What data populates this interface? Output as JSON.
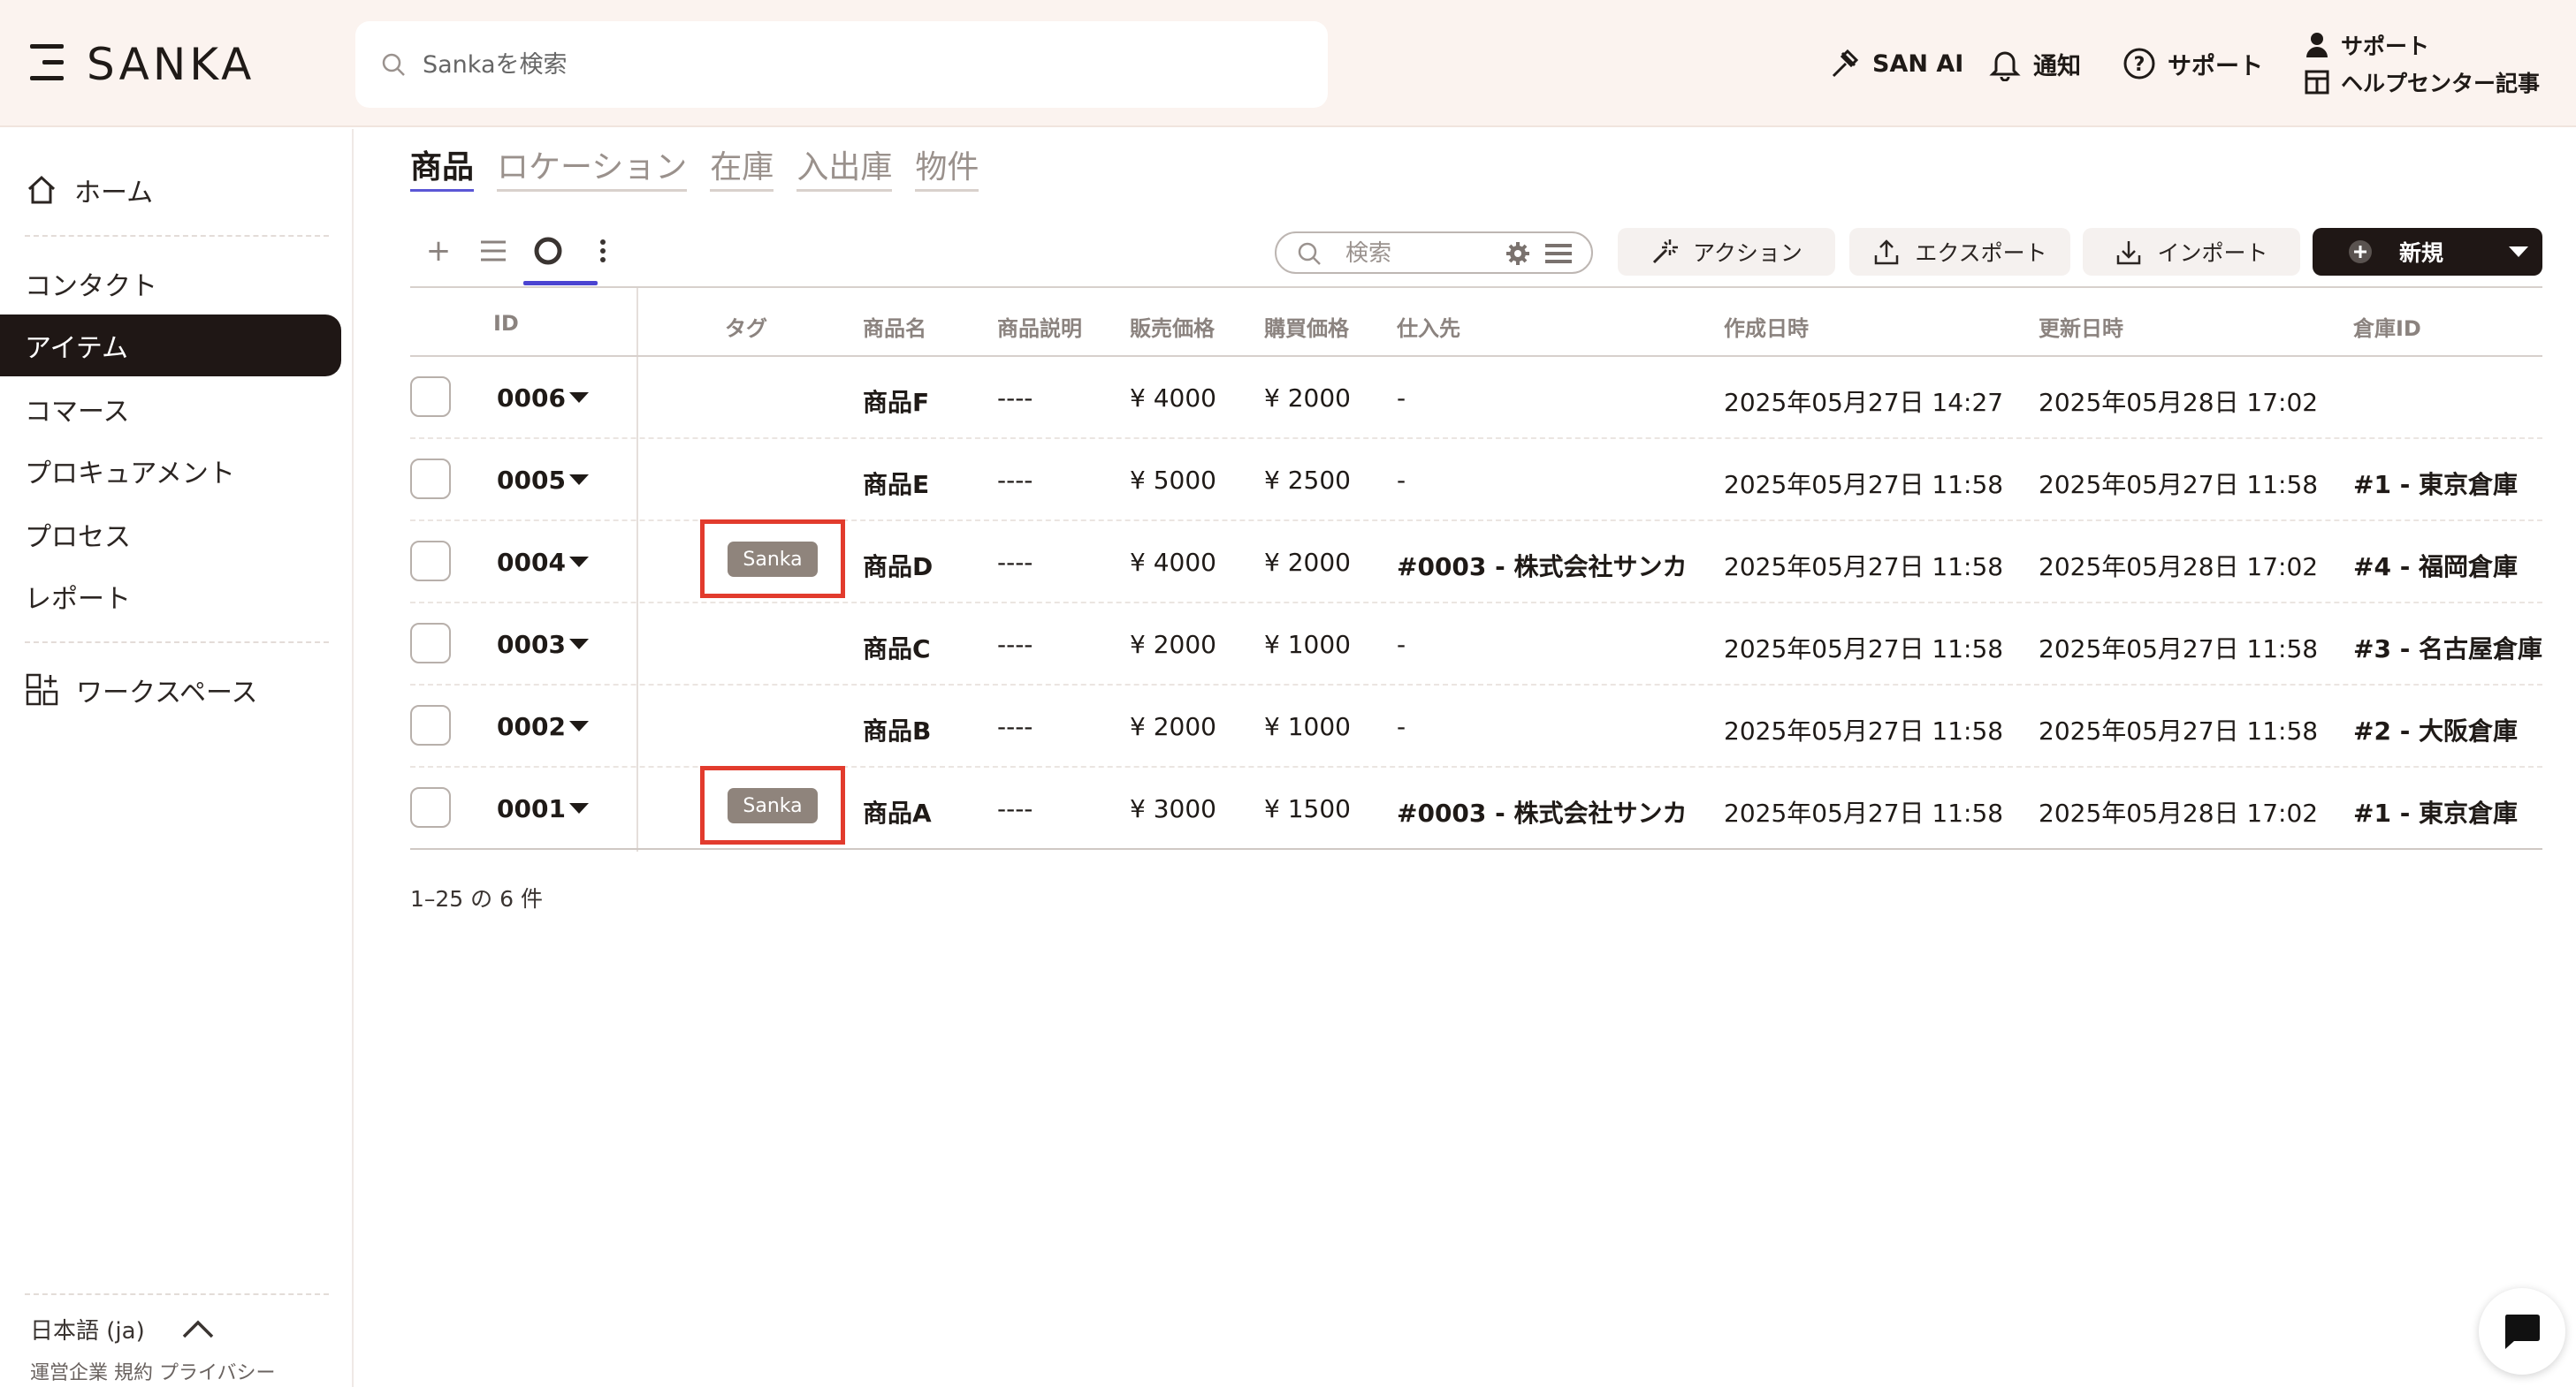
{
  "header": {
    "brand": "SANKA",
    "search_placeholder": "Sankaを検索",
    "san_ai": "SAN AI",
    "notifications": "通知",
    "support": "サポート",
    "support_person": "サポート",
    "help_center": "ヘルプセンター記事"
  },
  "sidebar": {
    "items": [
      {
        "label": "ホーム",
        "icon": "home-icon"
      },
      {
        "label": "コンタクト"
      },
      {
        "label": "アイテム",
        "active": true
      },
      {
        "label": "コマース"
      },
      {
        "label": "プロキュアメント"
      },
      {
        "label": "プロセス"
      },
      {
        "label": "レポート"
      },
      {
        "label": "ワークスペース",
        "icon": "workspace-icon"
      }
    ],
    "language": "日本語 (ja)",
    "footer_links": "運営企業 規約 プライバシー"
  },
  "tabs": [
    "商品",
    "ロケーション",
    "在庫",
    "入出庫",
    "物件"
  ],
  "toolbar": {
    "search_placeholder": "検索",
    "action": "アクション",
    "export": "エクスポート",
    "import": "インポート",
    "new": "新規"
  },
  "table": {
    "columns": [
      "ID",
      "タグ",
      "商品名",
      "商品説明",
      "販売価格",
      "購買価格",
      "仕入先",
      "作成日時",
      "更新日時",
      "倉庫ID"
    ],
    "rows": [
      {
        "id": "0006",
        "tag": "",
        "name": "商品F",
        "desc": "----",
        "sell": "¥ 4000",
        "buy": "¥ 2000",
        "supplier": "-",
        "created": "2025年05月27日 14:27",
        "updated": "2025年05月28日 17:02",
        "warehouse": ""
      },
      {
        "id": "0005",
        "tag": "",
        "name": "商品E",
        "desc": "----",
        "sell": "¥ 5000",
        "buy": "¥ 2500",
        "supplier": "-",
        "created": "2025年05月27日 11:58",
        "updated": "2025年05月27日 11:58",
        "warehouse": "#1 - 東京倉庫"
      },
      {
        "id": "0004",
        "tag": "Sanka",
        "name": "商品D",
        "desc": "----",
        "sell": "¥ 4000",
        "buy": "¥ 2000",
        "supplier": "#0003 - 株式会社サンカ",
        "created": "2025年05月27日 11:58",
        "updated": "2025年05月28日 17:02",
        "warehouse": "#4 - 福岡倉庫"
      },
      {
        "id": "0003",
        "tag": "",
        "name": "商品C",
        "desc": "----",
        "sell": "¥ 2000",
        "buy": "¥ 1000",
        "supplier": "-",
        "created": "2025年05月27日 11:58",
        "updated": "2025年05月27日 11:58",
        "warehouse": "#3 - 名古屋倉庫"
      },
      {
        "id": "0002",
        "tag": "",
        "name": "商品B",
        "desc": "----",
        "sell": "¥ 2000",
        "buy": "¥ 1000",
        "supplier": "-",
        "created": "2025年05月27日 11:58",
        "updated": "2025年05月27日 11:58",
        "warehouse": "#2 - 大阪倉庫"
      },
      {
        "id": "0001",
        "tag": "Sanka",
        "name": "商品A",
        "desc": "----",
        "sell": "¥ 3000",
        "buy": "¥ 1500",
        "supplier": "#0003 - 株式会社サンカ",
        "created": "2025年05月27日 11:58",
        "updated": "2025年05月28日 17:02",
        "warehouse": "#1 - 東京倉庫"
      }
    ]
  },
  "pagination": "1–25 の 6 件",
  "colors": {
    "accent": "#4b44d1",
    "dark": "#1f1715",
    "header_bg": "#fbf3ef",
    "tag_bg": "#8f847c",
    "highlight": "#e23b2d"
  }
}
